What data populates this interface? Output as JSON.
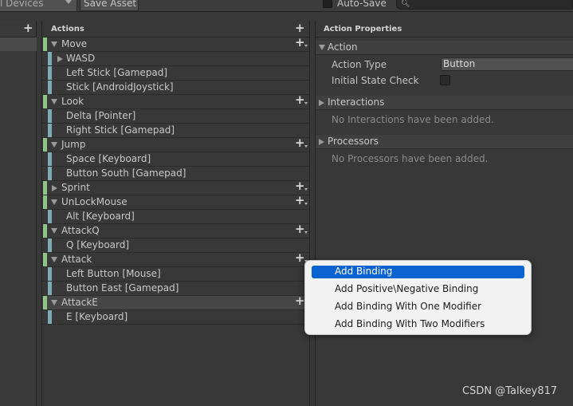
{
  "toolbar": {
    "devices_label": "l Devices",
    "save_label": "Save Asset",
    "autosave_label": "Auto-Save",
    "autosave_checked": false,
    "search_placeholder": ""
  },
  "action_maps": {
    "add_icon": "plus-icon"
  },
  "actions_panel": {
    "title": "Actions",
    "rows": [
      {
        "label": "Move",
        "kind": "action",
        "expanded": true
      },
      {
        "label": "WASD",
        "kind": "composite",
        "expanded": false
      },
      {
        "label": "Left Stick [Gamepad]",
        "kind": "binding"
      },
      {
        "label": "Stick [AndroidJoystick]",
        "kind": "binding"
      },
      {
        "label": "Look",
        "kind": "action",
        "expanded": true
      },
      {
        "label": "Delta [Pointer]",
        "kind": "binding"
      },
      {
        "label": "Right Stick [Gamepad]",
        "kind": "binding"
      },
      {
        "label": "Jump",
        "kind": "action",
        "expanded": true
      },
      {
        "label": "Space [Keyboard]",
        "kind": "binding"
      },
      {
        "label": "Button South [Gamepad]",
        "kind": "binding"
      },
      {
        "label": "Sprint",
        "kind": "action",
        "expanded": false
      },
      {
        "label": "UnLockMouse",
        "kind": "action",
        "expanded": true
      },
      {
        "label": "Alt [Keyboard]",
        "kind": "binding"
      },
      {
        "label": "AttackQ",
        "kind": "action",
        "expanded": true
      },
      {
        "label": "Q [Keyboard]",
        "kind": "binding"
      },
      {
        "label": "Attack",
        "kind": "action",
        "expanded": true
      },
      {
        "label": "Left Button [Mouse]",
        "kind": "binding"
      },
      {
        "label": "Button East [Gamepad]",
        "kind": "binding"
      },
      {
        "label": "AttackE",
        "kind": "action",
        "expanded": true,
        "selected": true
      },
      {
        "label": "E [Keyboard]",
        "kind": "binding"
      }
    ]
  },
  "properties_panel": {
    "title": "Action Properties",
    "action_section": "Action",
    "action_type_label": "Action Type",
    "action_type_value": "Button",
    "initial_state_label": "Initial State Check",
    "initial_state_checked": false,
    "interactions_section": "Interactions",
    "interactions_empty": "No Interactions have been added.",
    "processors_section": "Processors",
    "processors_empty": "No Processors have been added."
  },
  "context_menu": {
    "items": [
      {
        "label": "Add Binding",
        "highlighted": true
      },
      {
        "label": "Add Positive\\Negative Binding",
        "highlighted": false
      },
      {
        "label": "Add Binding With One Modifier",
        "highlighted": false
      },
      {
        "label": "Add Binding With Two Modifiers",
        "highlighted": false
      }
    ]
  },
  "watermark": "CSDN @Talkey817",
  "colors": {
    "background": "#383838",
    "action_bar": "#8fc38a",
    "binding_bar": "#7eaab4",
    "menu_highlight": "#0a63d0",
    "menu_background": "#f2f2f2"
  }
}
